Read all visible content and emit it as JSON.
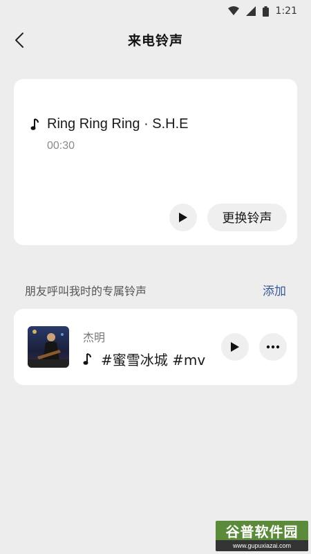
{
  "status_bar": {
    "time": "1:21"
  },
  "nav": {
    "title": "来电铃声"
  },
  "ringtone": {
    "name": "Ring Ring Ring · S.H.E",
    "duration": "00:30",
    "change_label": "更换铃声"
  },
  "section": {
    "title": "朋友呼叫我时的专属铃声",
    "add_label": "添加"
  },
  "contact": {
    "name": "杰明",
    "ringtone": "#蜜雪冰城 #mv"
  },
  "watermark": {
    "brand": "谷普软件园",
    "url": "www.gupuxiazai.com"
  },
  "colors": {
    "background": "#ededed",
    "card": "#ffffff",
    "accent_link": "#3a5a9a"
  }
}
